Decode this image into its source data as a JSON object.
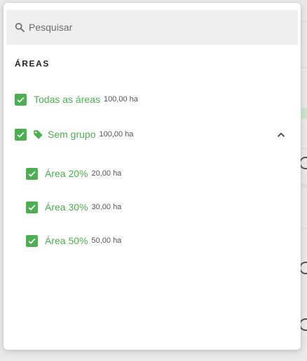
{
  "search": {
    "placeholder": "Pesquisar",
    "value": ""
  },
  "section": {
    "title": "ÁREAS"
  },
  "all_areas": {
    "label": "Todas as áreas",
    "area": "100,00 ha",
    "checked": true
  },
  "group": {
    "label": "Sem grupo",
    "area": "100,00 ha",
    "checked": true,
    "expanded": true,
    "icon": "tag-icon"
  },
  "areas": [
    {
      "label": "Área 20%",
      "area": "20,00 ha",
      "checked": true
    },
    {
      "label": "Área 30%",
      "area": "30,00 ha",
      "checked": true
    },
    {
      "label": "Área 50%",
      "area": "50,00 ha",
      "checked": true
    }
  ],
  "colors": {
    "accent": "#4caf50",
    "search_bg": "#efefef",
    "panel_bg": "#ffffff"
  }
}
